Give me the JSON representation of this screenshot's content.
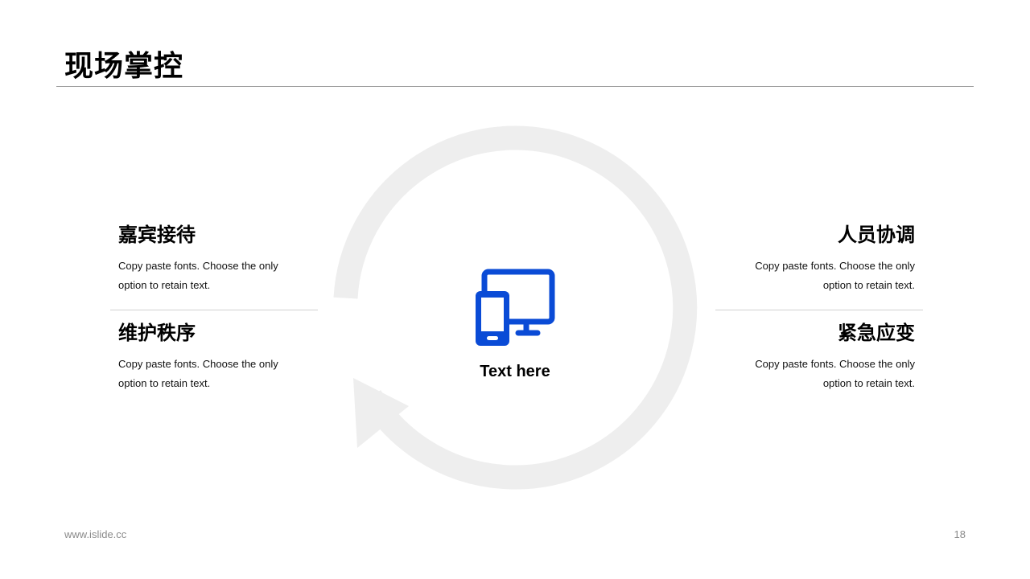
{
  "slide": {
    "title": "现场掌控",
    "center_label": "Text here",
    "accent_color": "#0A4BD6",
    "ring_color": "#EEEEEE",
    "center_icon": "devices-icon"
  },
  "blocks": [
    {
      "heading": "嘉宾接待",
      "text_line1": "Copy paste fonts. Choose the only",
      "text_line2": "option to retain text."
    },
    {
      "heading": "维护秩序",
      "text_line1": "Copy paste fonts. Choose the only",
      "text_line2": "option to retain text."
    },
    {
      "heading": "人员协调",
      "text_line1": "Copy paste fonts. Choose the only",
      "text_line2": "option to retain text."
    },
    {
      "heading": "紧急应变",
      "text_line1": "Copy paste fonts. Choose the only",
      "text_line2": "option to retain text."
    }
  ],
  "footer": {
    "url": "www.islide.cc",
    "page_number": "18"
  }
}
